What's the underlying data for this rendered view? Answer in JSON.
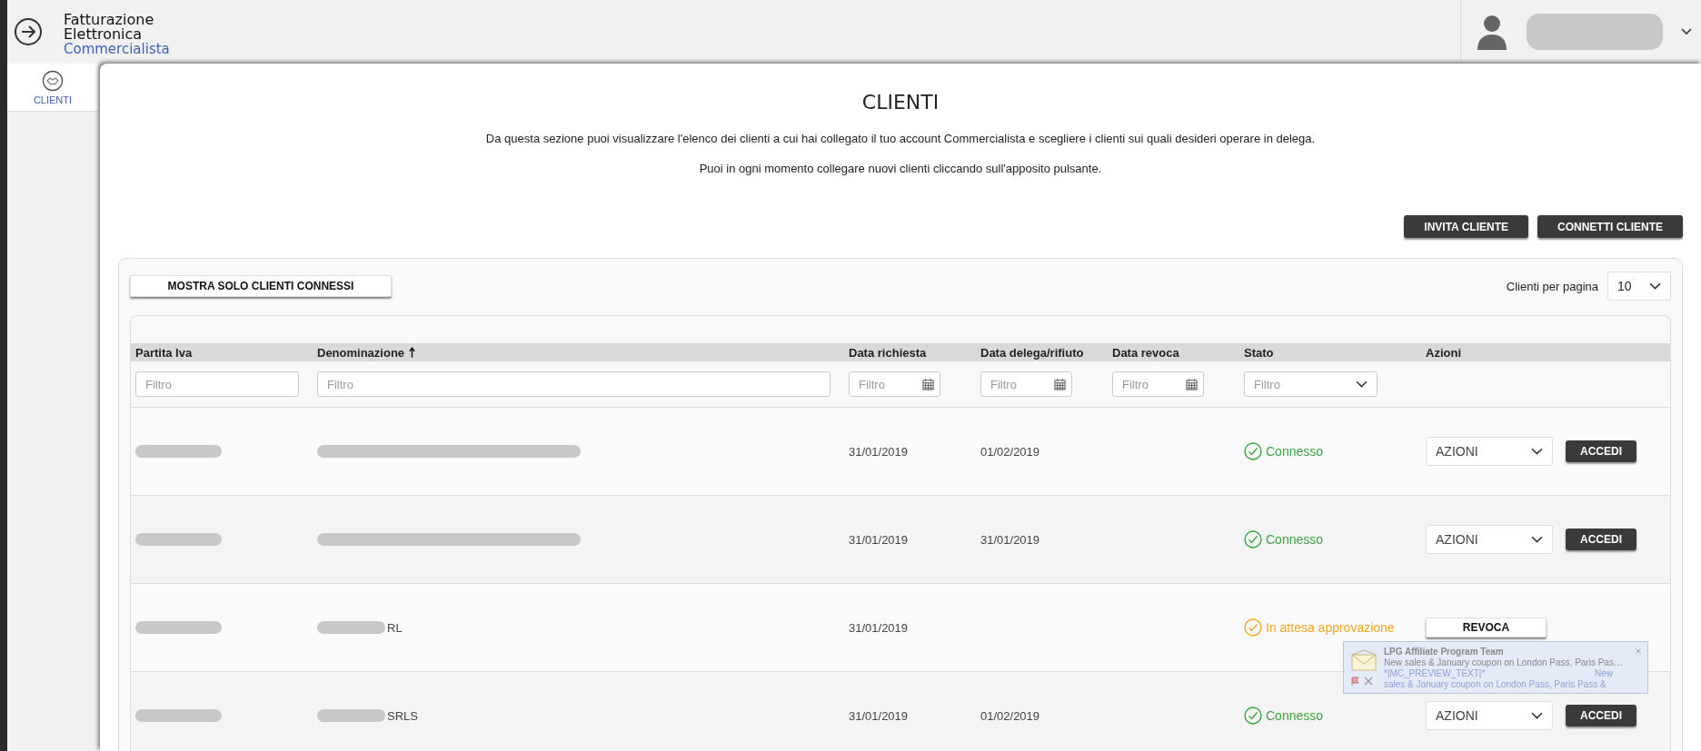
{
  "header": {
    "title_line1": "Fatturazione",
    "title_line2": "Elettronica",
    "subtitle": "Commercialista"
  },
  "sidebar": {
    "items": [
      {
        "label": "CLIENTI",
        "selected": true
      }
    ]
  },
  "page": {
    "title": "CLIENTI",
    "description": [
      "Da questa sezione puoi visualizzare l'elenco dei clienti a cui hai collegato il tuo account Commercialista e scegliere i clienti sui quali desideri operare in delega.",
      "Puoi in ogni momento collegare nuovi clienti cliccando sull'apposito pulsante."
    ]
  },
  "buttons": [
    "INVITA CLIENTE",
    "CONNETTI CLIENTE"
  ],
  "filter_button": "MOSTRA SOLO CLIENTI CONNESSI",
  "page_size": {
    "label": "Clienti per pagina",
    "value": "10"
  },
  "table": {
    "columns": [
      {
        "label": "Partita Iva",
        "kind": "text",
        "placeholder": "Filtro"
      },
      {
        "label": "Denominazione",
        "sorted": true,
        "kind": "text",
        "placeholder": "Filtro"
      },
      {
        "label": "Data richiesta",
        "kind": "date",
        "placeholder": "Filtro"
      },
      {
        "label": "Data delega/rifiuto",
        "kind": "date",
        "placeholder": "Filtro"
      },
      {
        "label": "Data revoca",
        "kind": "date",
        "placeholder": "Filtro"
      },
      {
        "label": "Stato",
        "kind": "select",
        "placeholder": "Filtro"
      },
      {
        "label": "Azioni",
        "kind": "none"
      }
    ],
    "rows": [
      {
        "data_richiesta": "31/01/2019",
        "data_delega": "01/02/2019",
        "status": {
          "label": "Connesso",
          "color": "#3aa641"
        },
        "actions": {
          "kind": "accedi",
          "select": "AZIONI",
          "button": "ACCEDI"
        }
      },
      {
        "data_richiesta": "31/01/2019",
        "data_delega": "31/01/2019",
        "status": {
          "label": "Connesso",
          "color": "#3aa641"
        },
        "actions": {
          "kind": "accedi",
          "select": "AZIONI",
          "button": "ACCEDI"
        }
      },
      {
        "name_fragment": "RL",
        "data_richiesta": "31/01/2019",
        "status": {
          "label": "In attesa approvazione",
          "color": "#f5a623"
        },
        "actions": {
          "kind": "revoca",
          "button": "REVOCA"
        }
      },
      {
        "name_fragment": "SRLS",
        "data_richiesta": "31/01/2019",
        "data_delega": "01/02/2019",
        "status": {
          "label": "Connesso",
          "color": "#3aa641"
        },
        "actions": {
          "kind": "accedi",
          "select": "AZIONI",
          "button": "ACCEDI"
        }
      }
    ]
  },
  "notification": {
    "sender": "LPG Affiliate Program Team",
    "subject": "New sales & January coupon on London Pass, Paris Pas…",
    "preview": "*|MC_PREVIEW_TEXT|*",
    "preview_tail": "New",
    "body": "sales & January coupon on London Pass, Paris Pass &"
  }
}
